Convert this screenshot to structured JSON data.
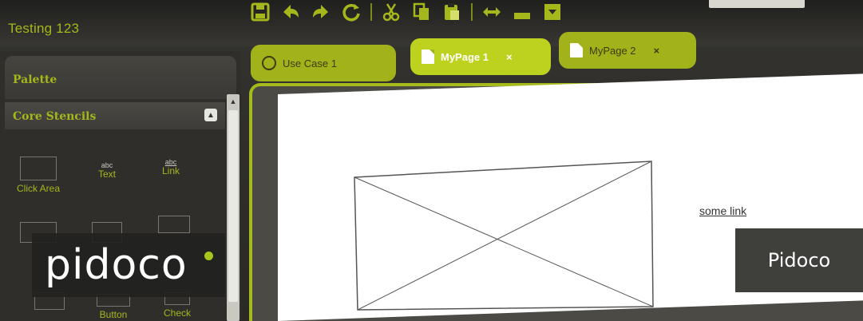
{
  "app": {
    "title": "Testing 123"
  },
  "toolbar": {
    "icons": [
      "save-icon",
      "undo-icon",
      "redo-icon",
      "refresh-icon",
      "cut-icon",
      "copy-icon",
      "paste-icon",
      "resize-icon",
      "minimize-icon",
      "download-icon"
    ]
  },
  "tabs": [
    {
      "label": "Use Case 1",
      "active": false,
      "closable": false
    },
    {
      "label": "MyPage 1",
      "active": true,
      "closable": true,
      "close_label": "×"
    },
    {
      "label": "MyPage 2",
      "active": false,
      "closable": true,
      "close_label": "×"
    }
  ],
  "sidebar": {
    "palette_label": "Palette",
    "section_label": "Core Stencils",
    "collapse_icon": "▲",
    "scroll_up_icon": "▲",
    "stencils": [
      {
        "label": "Click Area",
        "glyph": ""
      },
      {
        "label": "Text",
        "glyph": "abc"
      },
      {
        "label": "Link",
        "glyph": "abc"
      },
      {
        "label": "Button",
        "glyph": "abc"
      },
      {
        "label": "Check",
        "glyph": ""
      }
    ]
  },
  "canvas": {
    "link_text": "some link"
  },
  "logo": {
    "text": "pidoco"
  },
  "badge": {
    "text": "Pidoco"
  },
  "colors": {
    "accent": "#a5b71b",
    "tab_active": "#bcd21f",
    "dark": "#2f2e2b"
  }
}
